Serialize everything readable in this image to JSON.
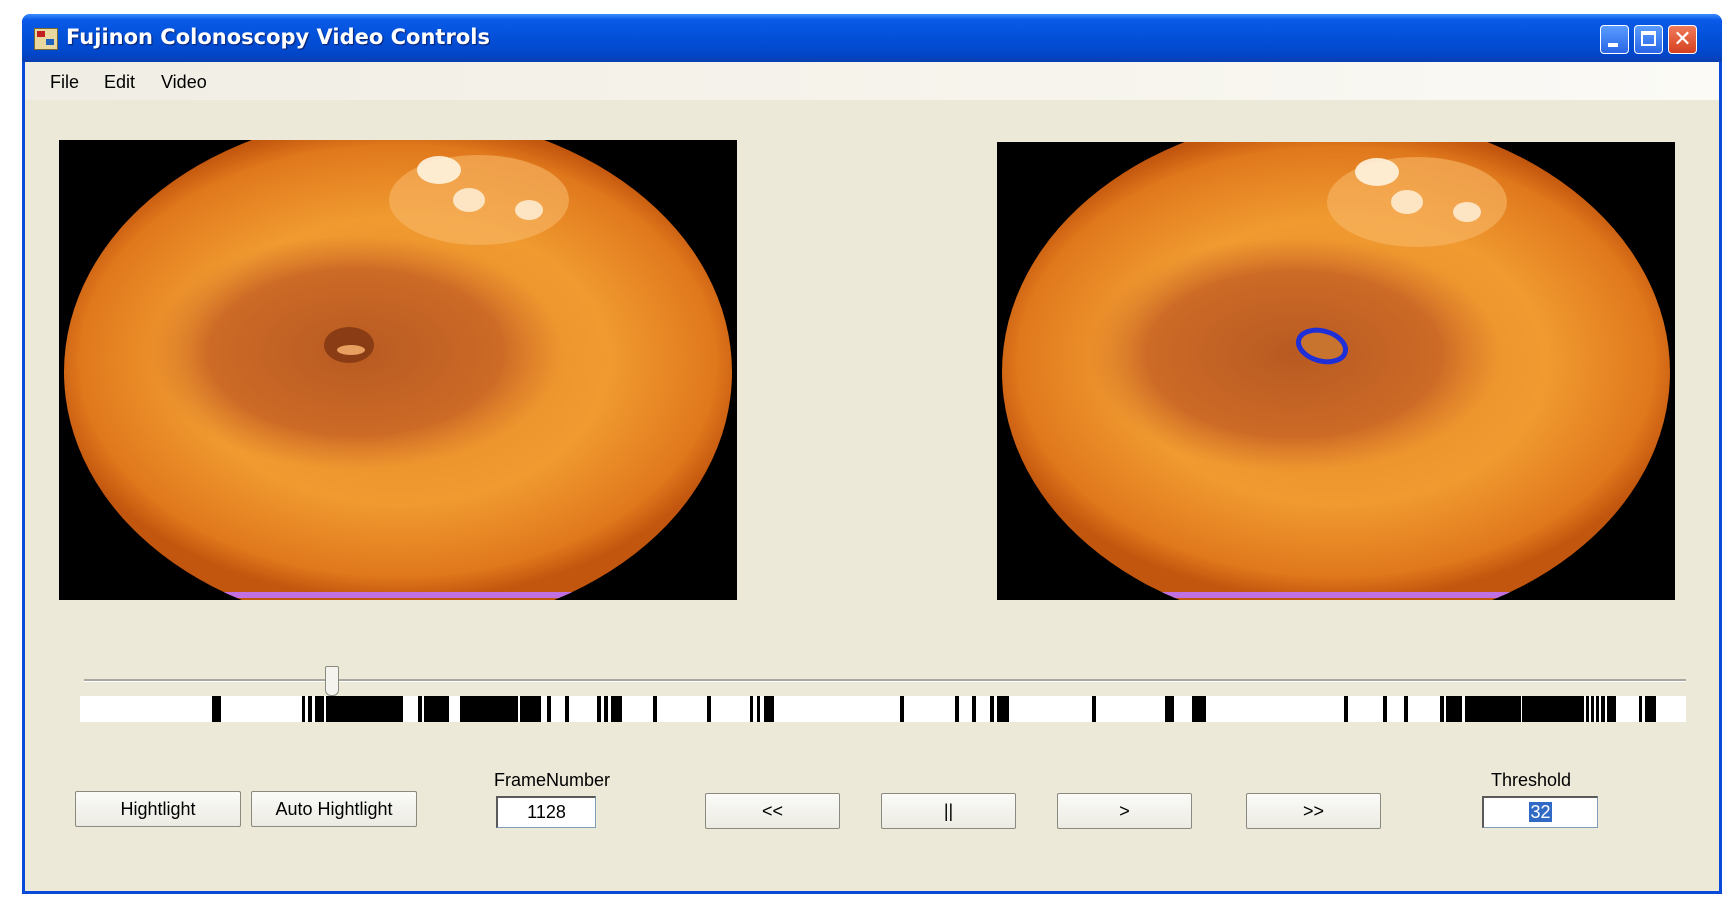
{
  "window": {
    "title": "Fujinon Colonoscopy Video Controls",
    "controls": {
      "minimize": "minimize-icon",
      "maximize": "maximize-icon",
      "close": "close-icon"
    }
  },
  "menu": {
    "items": [
      "File",
      "Edit",
      "Video"
    ]
  },
  "slider": {
    "position_fraction": 0.145
  },
  "controls": {
    "highlight_label": "Hightlight",
    "auto_highlight_label": "Auto Hightlight",
    "frame_number_label": "FrameNumber",
    "frame_number_value": "1128",
    "rewind_label": "<<",
    "pause_label": "||",
    "play_label": ">",
    "fast_forward_label": ">>",
    "threshold_label": "Threshold",
    "threshold_value": "32"
  },
  "colors": {
    "titlebar": "#0350d8",
    "client": "#ece9d8",
    "highlight_ring": "#1e2fd8",
    "selection": "#316ac5"
  }
}
